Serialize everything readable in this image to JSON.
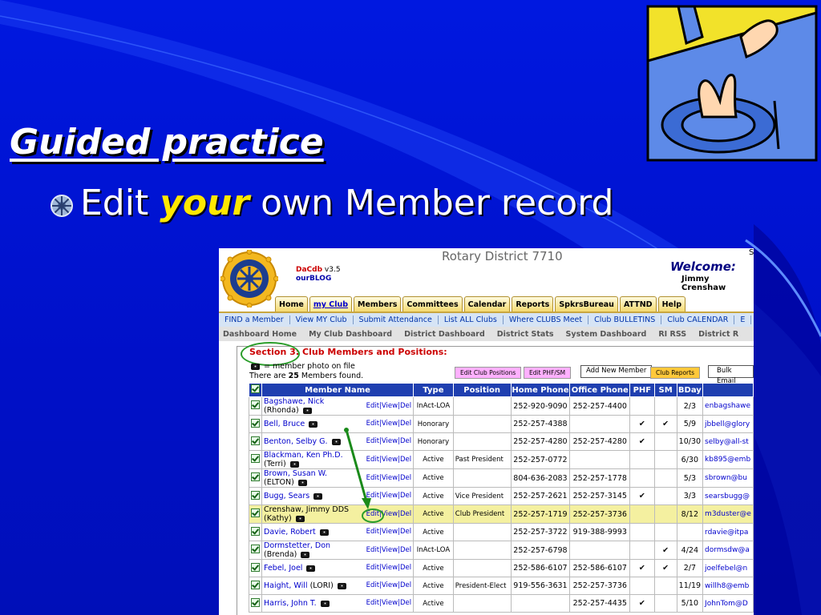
{
  "slide": {
    "title": "Guided practice",
    "bullet": {
      "pre": "Edit",
      "emph": "your",
      "post": "own Member record"
    }
  },
  "shot": {
    "district_title": "Rotary District 7710",
    "dacdb_name": "DaCdb",
    "dacdb_version": "v3.5",
    "blog": "ourBLOG",
    "welcome": "Welcome:",
    "user_name": "Jimmy Crenshaw",
    "top_right_char": "S",
    "tabs": [
      "Home",
      "my Club",
      "Members",
      "Committees",
      "Calendar",
      "Reports",
      "SpkrsBureau",
      "ATTND",
      "Help"
    ],
    "nav1": [
      "FIND a Member",
      "View MY Club",
      "Submit Attendance",
      "List ALL Clubs",
      "Where CLUBS Meet",
      "Club BULLETINS",
      "Club CALENDAR",
      "E"
    ],
    "nav2": [
      "Dashboard Home",
      "My Club Dashboard",
      "District Dashboard",
      "District Stats",
      "System Dashboard",
      "RI RSS",
      "District R"
    ],
    "section_label": "Section 3:",
    "section_rest": "Club Members and Positions:",
    "legend_photo": "= member photo on file",
    "legend_count_pre": "There are",
    "legend_count": "25",
    "legend_count_post": "Members found.",
    "buttons": {
      "edit_positions": "Edit Club Positions",
      "edit_phf": "Edit PHF/SM",
      "add_member": "Add New Member",
      "club_reports": "Club Reports",
      "bulk_email": "Bulk Email"
    },
    "columns": [
      "Member Name",
      "Type",
      "Position",
      "Home Phone",
      "Office Phone",
      "PHF",
      "SM",
      "BDay"
    ],
    "ops": "Edit|View|Del",
    "members": [
      {
        "name": "Bagshawe, Nick",
        "spouse": "(Rhonda)",
        "type": "InAct-LOA",
        "position": "",
        "home": "252-920-9090",
        "office": "252-257-4400",
        "phf": "",
        "sm": "",
        "bday": "2/3",
        "email": "enbagshawe"
      },
      {
        "name": "Bell, Bruce",
        "spouse": "",
        "type": "Honorary",
        "position": "",
        "home": "252-257-4388",
        "office": "",
        "phf": "✔",
        "sm": "✔",
        "bday": "5/9",
        "email": "jbbell@glory"
      },
      {
        "name": "Benton, Selby G.",
        "spouse": "",
        "type": "Honorary",
        "position": "",
        "home": "252-257-4280",
        "office": "252-257-4280",
        "phf": "✔",
        "sm": "",
        "bday": "10/30",
        "email": "selby@all-st"
      },
      {
        "name": "Blackman, Ken Ph.D.",
        "spouse": "(Terri)",
        "type": "Active",
        "position": "Past President",
        "home": "252-257-0772",
        "office": "",
        "phf": "",
        "sm": "",
        "bday": "6/30",
        "email": "kb895@emb"
      },
      {
        "name": "Brown, Susan W.",
        "spouse": "(ELTON)",
        "type": "Active",
        "position": "",
        "home": "804-636-2083",
        "office": "252-257-1778",
        "phf": "",
        "sm": "",
        "bday": "5/3",
        "email": "sbrown@bu"
      },
      {
        "name": "Bugg, Sears",
        "spouse": "",
        "type": "Active",
        "position": "Vice President",
        "home": "252-257-2621",
        "office": "252-257-3145",
        "phf": "✔",
        "sm": "",
        "bday": "3/3",
        "email": "searsbugg@"
      },
      {
        "name": "Crenshaw, Jimmy DDS",
        "spouse": "(Kathy)",
        "type": "Active",
        "position": "Club President",
        "home": "252-257-1719",
        "office": "252-257-3736",
        "phf": "",
        "sm": "",
        "bday": "8/12",
        "email": "m3duster@e"
      },
      {
        "name": "Davie, Robert",
        "spouse": "",
        "type": "Active",
        "position": "",
        "home": "252-257-3722",
        "office": "919-388-9993",
        "phf": "",
        "sm": "",
        "bday": "",
        "email": "rdavie@itpa"
      },
      {
        "name": "Dormstetter, Don",
        "spouse": "(Brenda)",
        "type": "InAct-LOA",
        "position": "",
        "home": "252-257-6798",
        "office": "",
        "phf": "",
        "sm": "✔",
        "bday": "4/24",
        "email": "dormsdw@a"
      },
      {
        "name": "Febel, Joel",
        "spouse": "",
        "type": "Active",
        "position": "",
        "home": "252-586-6107",
        "office": "252-586-6107",
        "phf": "✔",
        "sm": "✔",
        "bday": "2/7",
        "email": "joelfebel@n"
      },
      {
        "name": "Haight, Will",
        "spouse": "(LORI)",
        "type": "Active",
        "position": "President-Elect",
        "home": "919-556-3631",
        "office": "252-257-3736",
        "phf": "",
        "sm": "",
        "bday": "11/19",
        "email": "willh8@emb"
      },
      {
        "name": "Harris, John T.",
        "spouse": "",
        "type": "Active",
        "position": "",
        "home": "",
        "office": "252-257-4435",
        "phf": "✔",
        "sm": "",
        "bday": "5/10",
        "email": "JohnTom@D"
      }
    ],
    "highlight_row": 6,
    "colors": {
      "header_bg": "#1f3fb0",
      "highlight": "#f4f0a0",
      "annotation": "#2a9d2a"
    }
  },
  "icons": [
    "rotary-logo-icon",
    "camera-icon",
    "checkbox-icon",
    "bullet-icon",
    "hand-clipart-icon"
  ]
}
